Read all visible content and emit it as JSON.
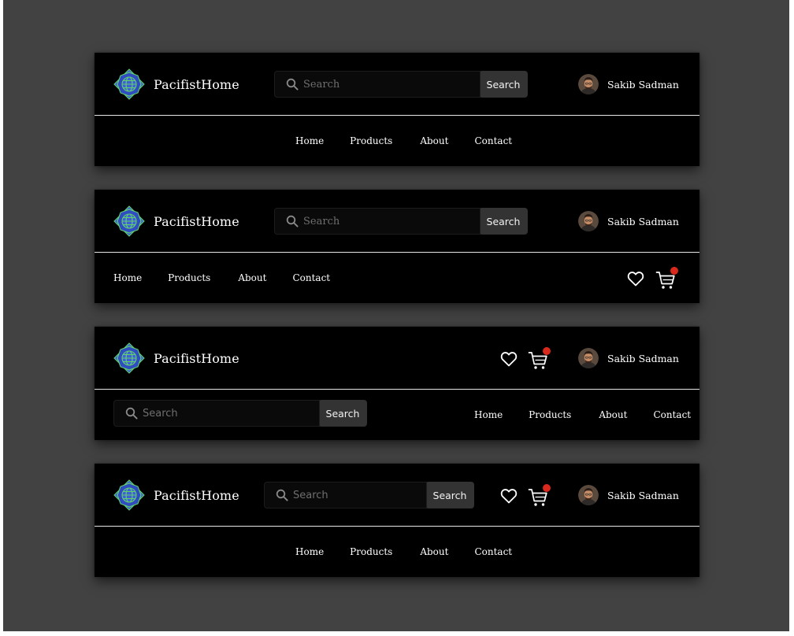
{
  "brand": {
    "name": "PacifistHome",
    "logo_icon": "globe-flower-logo",
    "logo_colors": {
      "petal": "#3f5fd6",
      "outline": "#61d26b"
    }
  },
  "search": {
    "placeholder": "Search",
    "button_label": "Search",
    "icon": "search-icon"
  },
  "user": {
    "name": "Sakib Sadman",
    "avatar_icon": "user-avatar"
  },
  "nav_links": {
    "home": "Home",
    "products": "Products",
    "about": "About",
    "contact": "Contact"
  },
  "icons": {
    "wishlist": "heart-icon",
    "cart": "cart-icon"
  },
  "colors": {
    "background": "#424242",
    "navbar": "#000000",
    "search_button": "#333333",
    "badge": "#d9291c",
    "text": "#ffffff"
  },
  "variants": [
    {
      "id": "variant-1",
      "layout": "centered search, user right; centered links below"
    },
    {
      "id": "variant-2",
      "layout": "centered search, user right; links left, wishlist and cart right"
    },
    {
      "id": "variant-3",
      "layout": "wishlist, cart and user right; search left, links right below"
    },
    {
      "id": "variant-4",
      "layout": "search, wishlist, cart and user in top row; centered links below"
    }
  ]
}
